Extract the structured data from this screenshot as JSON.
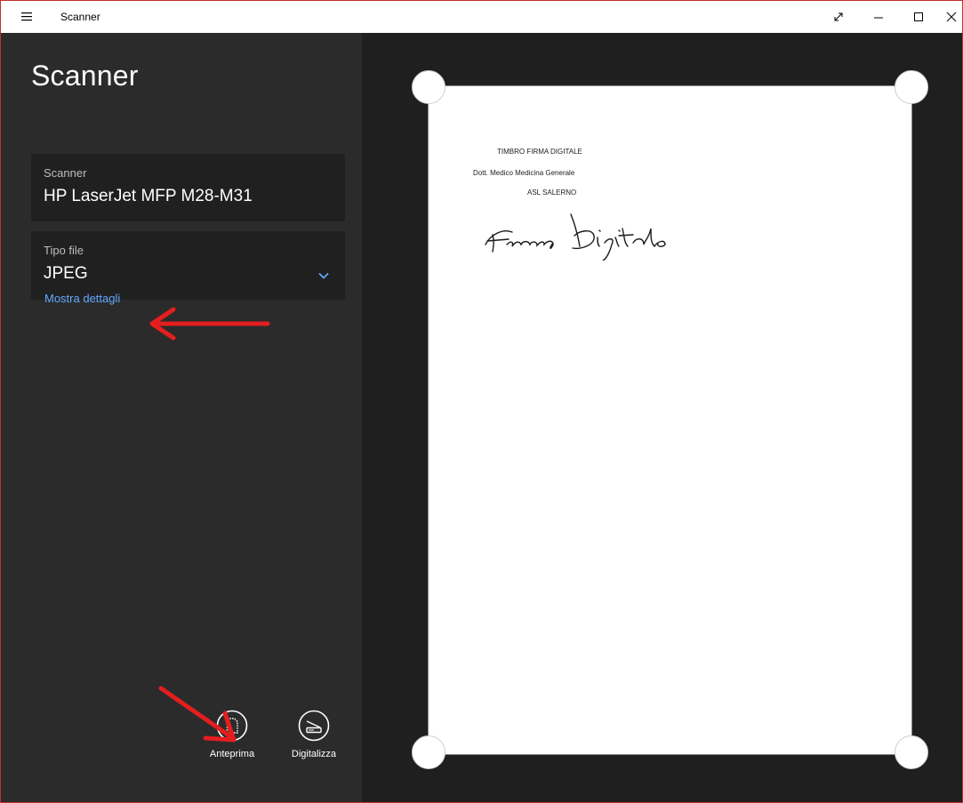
{
  "window": {
    "title": "Scanner"
  },
  "panel": {
    "heading": "Scanner",
    "scanner_field": {
      "label": "Scanner",
      "value": "HP LaserJet MFP M28-M31"
    },
    "filetype_field": {
      "label": "Tipo file",
      "value": "JPEG"
    },
    "details_link": "Mostra dettagli",
    "actions": [
      {
        "label": "Anteprima",
        "icon": "preview-document-icon"
      },
      {
        "label": "Digitalizza",
        "icon": "scanner-icon"
      }
    ]
  },
  "preview": {
    "document_lines": [
      "TIMBRO FIRMA DIGITALE",
      "Dott. Medico Medicina Generale",
      "ASL SALERNO"
    ],
    "signature": "Firma Digitale"
  },
  "colors": {
    "accent": "#63a9ff",
    "annotation": "#e31e1e"
  }
}
